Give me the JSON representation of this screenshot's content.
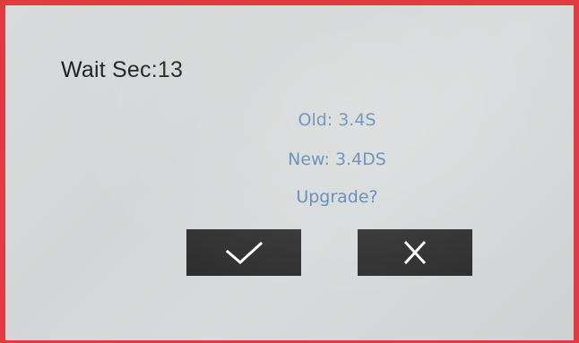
{
  "dialog": {
    "wait_label": "Wait Sec:13",
    "old_version": "Old: 3.4S",
    "new_version": "New: 3.4DS",
    "prompt": "Upgrade?"
  },
  "buttons": {
    "confirm_icon": "checkmark-icon",
    "cancel_icon": "close-icon"
  },
  "colors": {
    "border": "#e23a3f",
    "info_text": "#5a86b5",
    "button_bg": "#2e2e2e",
    "icon": "#ffffff"
  }
}
